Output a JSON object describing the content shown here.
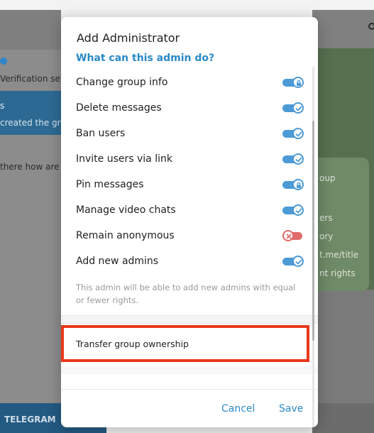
{
  "background": {
    "left_texts": [
      "Verification sett",
      "s",
      "created the gro",
      "there how are"
    ],
    "right_texts": [
      "oup",
      "ers",
      "ory",
      "t.me/title",
      "nt rights"
    ],
    "footer_left": "TELEGRAM"
  },
  "dialog": {
    "title": "Add Administrator",
    "section_title": "What can this admin do?",
    "permissions": [
      {
        "label": "Change group info",
        "state": "on",
        "icon": "lock-icon"
      },
      {
        "label": "Delete messages",
        "state": "on",
        "icon": "check-icon"
      },
      {
        "label": "Ban users",
        "state": "on",
        "icon": "check-icon"
      },
      {
        "label": "Invite users via link",
        "state": "on",
        "icon": "check-icon"
      },
      {
        "label": "Pin messages",
        "state": "on",
        "icon": "lock-icon"
      },
      {
        "label": "Manage video chats",
        "state": "on",
        "icon": "check-icon"
      },
      {
        "label": "Remain anonymous",
        "state": "off",
        "icon": "x-icon"
      },
      {
        "label": "Add new admins",
        "state": "on",
        "icon": "check-icon"
      }
    ],
    "note": "This admin will be able to add new admins with equal or fewer rights.",
    "transfer_label": "Transfer group ownership",
    "cancel_label": "Cancel",
    "save_label": "Save"
  },
  "colors": {
    "accent": "#2a8ac7",
    "toggle_on": "#4c9ad6",
    "toggle_off": "#e26b6b",
    "highlight": "#e8381c"
  }
}
